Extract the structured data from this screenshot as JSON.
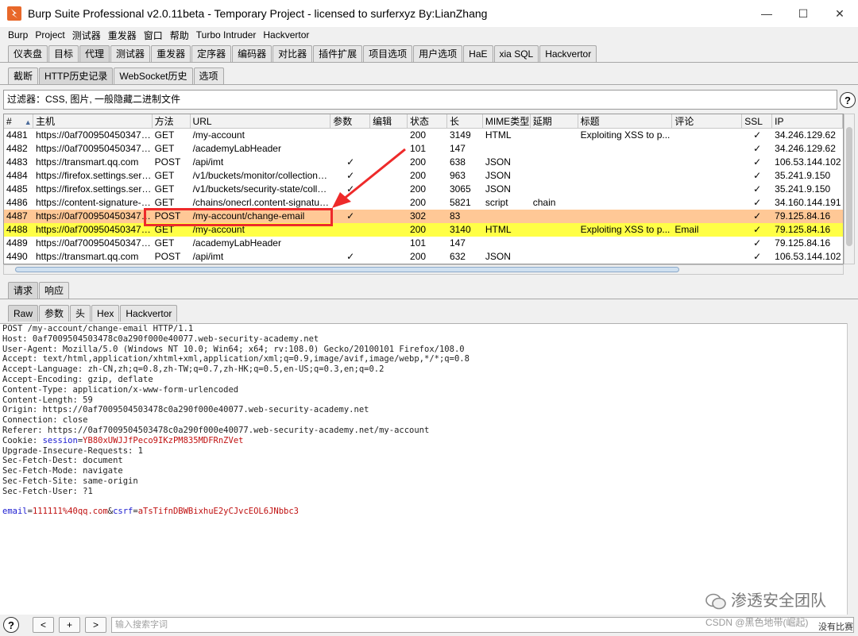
{
  "window": {
    "title": "Burp Suite Professional v2.0.11beta - Temporary Project - licensed to surferxyz By:LianZhang"
  },
  "menubar": [
    "Burp",
    "Project",
    "测试器",
    "重发器",
    "窗口",
    "帮助",
    "Turbo Intruder",
    "Hackvertor"
  ],
  "main_tabs": [
    "仪表盘",
    "目标",
    "代理",
    "测试器",
    "重发器",
    "定序器",
    "编码器",
    "对比器",
    "插件扩展",
    "项目选项",
    "用户选项",
    "HaE",
    "xia SQL",
    "Hackvertor"
  ],
  "main_tab_active": "代理",
  "proxy_tabs": [
    "截断",
    "HTTP历史记录",
    "WebSocket历史",
    "选项"
  ],
  "proxy_tab_active": "HTTP历史记录",
  "filter": {
    "text": "过滤器：CSS, 图片, 一般隐藏二进制文件"
  },
  "help_icon_label": "?",
  "table": {
    "columns": [
      "#",
      "主机",
      "方法",
      "URL",
      "参数",
      "编辑",
      "状态",
      "长",
      "MIME类型",
      "延期",
      "标题",
      "评论",
      "SSL",
      "IP"
    ],
    "sort_indicator": "▲",
    "rows": [
      {
        "id": "4481",
        "host": "https://0af7009504503478...",
        "method": "GET",
        "url": "/my-account",
        "params": "",
        "edited": "",
        "status": "200",
        "length": "3149",
        "mime": "HTML",
        "ext": "",
        "title": "Exploiting XSS to p...",
        "comment": "",
        "ssl": "✓",
        "ip": "34.246.129.62",
        "highlight": ""
      },
      {
        "id": "4482",
        "host": "https://0af7009504503478...",
        "method": "GET",
        "url": "/academyLabHeader",
        "params": "",
        "edited": "",
        "status": "101",
        "length": "147",
        "mime": "",
        "ext": "",
        "title": "",
        "comment": "",
        "ssl": "✓",
        "ip": "34.246.129.62",
        "highlight": ""
      },
      {
        "id": "4483",
        "host": "https://transmart.qq.com",
        "method": "POST",
        "url": "/api/imt",
        "params": "✓",
        "edited": "",
        "status": "200",
        "length": "638",
        "mime": "JSON",
        "ext": "",
        "title": "",
        "comment": "",
        "ssl": "✓",
        "ip": "106.53.144.102",
        "highlight": ""
      },
      {
        "id": "4484",
        "host": "https://firefox.settings.serv...",
        "method": "GET",
        "url": "/v1/buckets/monitor/collections/...",
        "params": "✓",
        "edited": "",
        "status": "200",
        "length": "963",
        "mime": "JSON",
        "ext": "",
        "title": "",
        "comment": "",
        "ssl": "✓",
        "ip": "35.241.9.150",
        "highlight": ""
      },
      {
        "id": "4485",
        "host": "https://firefox.settings.serv...",
        "method": "GET",
        "url": "/v1/buckets/security-state/collec...",
        "params": "✓",
        "edited": "",
        "status": "200",
        "length": "3065",
        "mime": "JSON",
        "ext": "",
        "title": "",
        "comment": "",
        "ssl": "✓",
        "ip": "35.241.9.150",
        "highlight": ""
      },
      {
        "id": "4486",
        "host": "https://content-signature-2...",
        "method": "GET",
        "url": "/chains/onecrl.content-signature...",
        "params": "",
        "edited": "",
        "status": "200",
        "length": "5821",
        "mime": "script",
        "ext": "chain",
        "title": "",
        "comment": "",
        "ssl": "✓",
        "ip": "34.160.144.191",
        "highlight": ""
      },
      {
        "id": "4487",
        "host": "https://0af7009504503478...",
        "method": "POST",
        "url": "/my-account/change-email",
        "params": "✓",
        "edited": "",
        "status": "302",
        "length": "83",
        "mime": "",
        "ext": "",
        "title": "",
        "comment": "",
        "ssl": "✓",
        "ip": "79.125.84.16",
        "highlight": "orange"
      },
      {
        "id": "4488",
        "host": "https://0af7009504503478...",
        "method": "GET",
        "url": "/my-account",
        "params": "",
        "edited": "",
        "status": "200",
        "length": "3140",
        "mime": "HTML",
        "ext": "",
        "title": "Exploiting XSS to p...",
        "comment": "Email",
        "ssl": "✓",
        "ip": "79.125.84.16",
        "highlight": "yellow"
      },
      {
        "id": "4489",
        "host": "https://0af7009504503478...",
        "method": "GET",
        "url": "/academyLabHeader",
        "params": "",
        "edited": "",
        "status": "101",
        "length": "147",
        "mime": "",
        "ext": "",
        "title": "",
        "comment": "",
        "ssl": "✓",
        "ip": "79.125.84.16",
        "highlight": ""
      },
      {
        "id": "4490",
        "host": "https://transmart.qq.com",
        "method": "POST",
        "url": "/api/imt",
        "params": "✓",
        "edited": "",
        "status": "200",
        "length": "632",
        "mime": "JSON",
        "ext": "",
        "title": "",
        "comment": "",
        "ssl": "✓",
        "ip": "106.53.144.102",
        "highlight": ""
      }
    ]
  },
  "req_resp_tabs": [
    "请求",
    "响应"
  ],
  "req_resp_active": "请求",
  "view_tabs": [
    "Raw",
    "参数",
    "头",
    "Hex",
    "Hackvertor"
  ],
  "view_tab_active": "Raw",
  "request": {
    "lines": [
      "POST /my-account/change-email HTTP/1.1",
      "Host: 0af7009504503478c0a290f000e40077.web-security-academy.net",
      "User-Agent: Mozilla/5.0 (Windows NT 10.0; Win64; x64; rv:108.0) Gecko/20100101 Firefox/108.0",
      "Accept: text/html,application/xhtml+xml,application/xml;q=0.9,image/avif,image/webp,*/*;q=0.8",
      "Accept-Language: zh-CN,zh;q=0.8,zh-TW;q=0.7,zh-HK;q=0.5,en-US;q=0.3,en;q=0.2",
      "Accept-Encoding: gzip, deflate",
      "Content-Type: application/x-www-form-urlencoded",
      "Content-Length: 59",
      "Origin: https://0af7009504503478c0a290f000e40077.web-security-academy.net",
      "Connection: close",
      "Referer: https://0af7009504503478c0a290f000e40077.web-security-academy.net/my-account"
    ],
    "cookie_prefix": "Cookie: ",
    "cookie_key": "session",
    "cookie_eq": "=",
    "cookie_value": "YB80xUWJJfPeco9IKzPM835MDFRnZVet",
    "lines2": [
      "Upgrade-Insecure-Requests: 1",
      "Sec-Fetch-Dest: document",
      "Sec-Fetch-Mode: navigate",
      "Sec-Fetch-Site: same-origin",
      "Sec-Fetch-User: ?1"
    ],
    "body_key1": "email",
    "body_val1": "111111%40qq.com",
    "body_amp": "&",
    "body_key2": "csrf",
    "body_val2": "aTsTifnDBWBixhuE2yCJvcEOL6JNbbc3"
  },
  "bottombar": {
    "help": "?",
    "prev": "<",
    "add": "+",
    "next": ">",
    "search_placeholder": "输入搜索字词",
    "match_label": "没有比赛"
  },
  "watermark": {
    "line1": "渗透安全团队",
    "line2": "CSDN @黑色地带(崛起)"
  },
  "colors": {
    "orange_row": "#ffc896",
    "yellow_row": "#ffff46",
    "highlight_box": "#ee2a2a",
    "burp_logo": "#e8682a"
  }
}
